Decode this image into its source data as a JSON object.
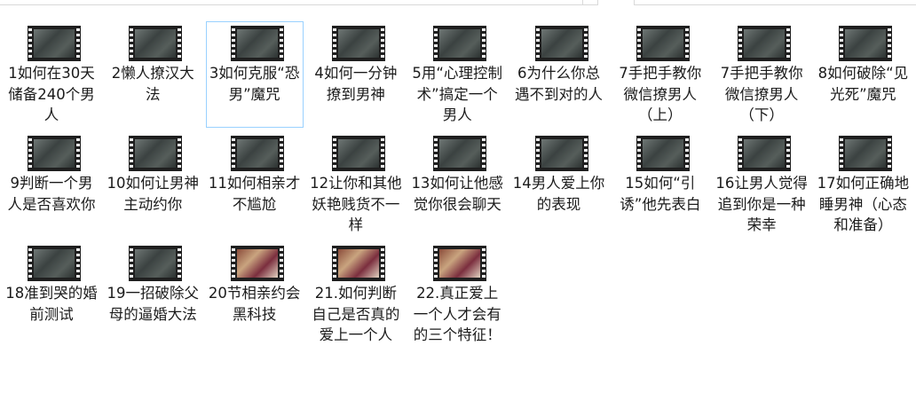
{
  "files": [
    {
      "name": "1如何在30天储备240个男人",
      "thumb": "gray"
    },
    {
      "name": "2懒人撩汉大法",
      "thumb": "gray"
    },
    {
      "name": "3如何克服“恐男”魔咒",
      "thumb": "gray",
      "selected": true
    },
    {
      "name": "4如何一分钟撩到男神",
      "thumb": "gray"
    },
    {
      "name": "5用“心理控制术”搞定一个男人",
      "thumb": "gray"
    },
    {
      "name": "6为什么你总遇不到对的人",
      "thumb": "gray"
    },
    {
      "name": "7手把手教你微信撩男人（上）",
      "thumb": "gray"
    },
    {
      "name": "7手把手教你微信撩男人（下）",
      "thumb": "gray"
    },
    {
      "name": "8如何破除“见光死”魔咒",
      "thumb": "gray"
    },
    {
      "name": "9判断一个男人是否喜欢你",
      "thumb": "gray"
    },
    {
      "name": "10如何让男神主动约你",
      "thumb": "gray"
    },
    {
      "name": "11如何相亲才不尴尬",
      "thumb": "gray"
    },
    {
      "name": "12让你和其他妖艳贱货不一样",
      "thumb": "gray"
    },
    {
      "name": "13如何让他感觉你很会聊天",
      "thumb": "gray"
    },
    {
      "name": "14男人爱上你的表现",
      "thumb": "gray"
    },
    {
      "name": "15如何“引诱”他先表白",
      "thumb": "gray"
    },
    {
      "name": "16让男人觉得追到你是一种荣幸",
      "thumb": "gray"
    },
    {
      "name": "17如何正确地睡男神（心态和准备）",
      "thumb": "gray"
    },
    {
      "name": "18准到哭的婚前测试",
      "thumb": "gray"
    },
    {
      "name": "19一招破除父母的逼婚大法",
      "thumb": "gray"
    },
    {
      "name": "20节相亲约会黑科技",
      "thumb": "color"
    },
    {
      "name": "21.如何判断自己是否真的爱上一个人",
      "thumb": "color"
    },
    {
      "name": "22.真正爱上一个人才会有的三个特征！",
      "thumb": "color"
    }
  ]
}
